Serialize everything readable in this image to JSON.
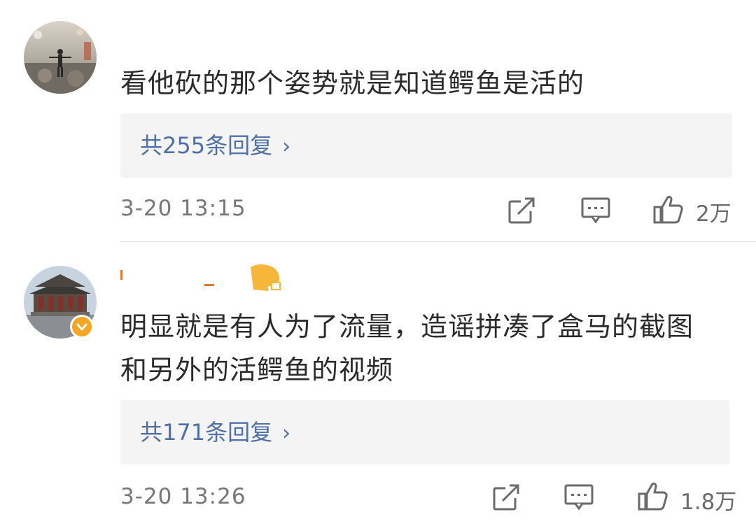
{
  "comments": [
    {
      "text": "看他砍的那个姿势就是知道鳄鱼是活的",
      "reply_label": "共255条回复",
      "reply_chevron": "›",
      "time": "3-20 13:15",
      "likes": "2万",
      "icons": [
        "share-icon",
        "comment-icon",
        "like-icon",
        "chevron-right-icon"
      ]
    },
    {
      "text_lines": [
        "明显就是有人为了流量，造谣拼凑了盒马的截图",
        "和另外的活鳄鱼的视频"
      ],
      "reply_label": "共171条回复",
      "reply_chevron": "›",
      "time": "3-20 13:26",
      "likes": "1.8万",
      "verified": true,
      "icons": [
        "share-icon",
        "comment-icon",
        "like-icon",
        "chevron-right-icon",
        "verified-badge-icon"
      ]
    }
  ],
  "colors": {
    "link": "#4f6fa8",
    "reply_bg": "#f4f4f4",
    "meta": "#777777",
    "verified": "#f5a623"
  }
}
